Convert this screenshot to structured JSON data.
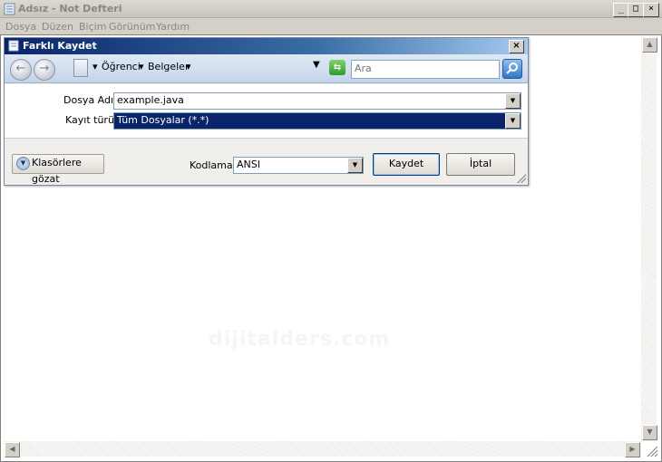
{
  "notepad": {
    "title": "Adsız - Not Defteri",
    "menu": [
      "Dosya",
      "Düzen",
      "Biçim",
      "Görünüm",
      "Yardım"
    ],
    "window_controls": {
      "minimize": "_",
      "maximize": "□",
      "close": "×"
    },
    "watermark": "dijitalders.com"
  },
  "dialog": {
    "title": "Farklı Kaydet",
    "close": "×",
    "breadcrumb": [
      "Öğrenci",
      "Belgeler"
    ],
    "search_placeholder": "Ara",
    "file_name_label": "Dosya Adı:",
    "file_name_value": "example.java",
    "file_type_label": "Kayıt türü:",
    "file_type_value": "Tüm Dosyalar  (*.*)",
    "browse_folders_label": "Klasörlere gözat",
    "encoding_label": "Kodlama:",
    "encoding_value": "ANSI",
    "save_button": "Kaydet",
    "cancel_button": "İptal"
  },
  "icons": {
    "back": "back-arrow-icon",
    "forward": "forward-arrow-icon",
    "refresh": "refresh-icon",
    "search": "search-icon"
  }
}
